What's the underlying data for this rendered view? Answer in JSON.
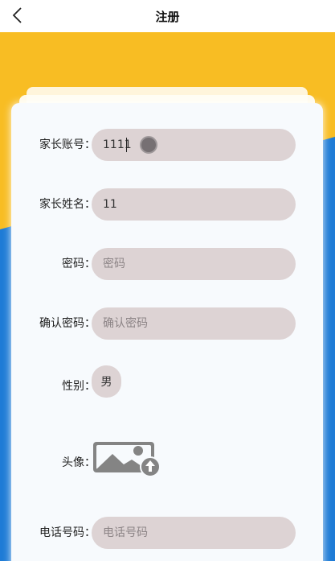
{
  "header": {
    "title": "注册"
  },
  "colors": {
    "yellow": "#f8bd23",
    "blue": "#1e7bd6",
    "field_bg": "#ddd3d4"
  },
  "icons": {
    "back": "chevron-left-icon",
    "avatar": "image-upload-icon"
  },
  "form": {
    "account": {
      "label": "家长账号：",
      "value": "1111"
    },
    "name": {
      "label": "家长姓名：",
      "value": "11"
    },
    "password": {
      "label": "密码：",
      "placeholder": "密码"
    },
    "confirm": {
      "label": "确认密码：",
      "placeholder": "确认密码"
    },
    "gender": {
      "label": "性别：",
      "value": "男"
    },
    "avatar": {
      "label": "头像："
    },
    "phone": {
      "label": "电话号码：",
      "placeholder": "电话号码"
    }
  }
}
